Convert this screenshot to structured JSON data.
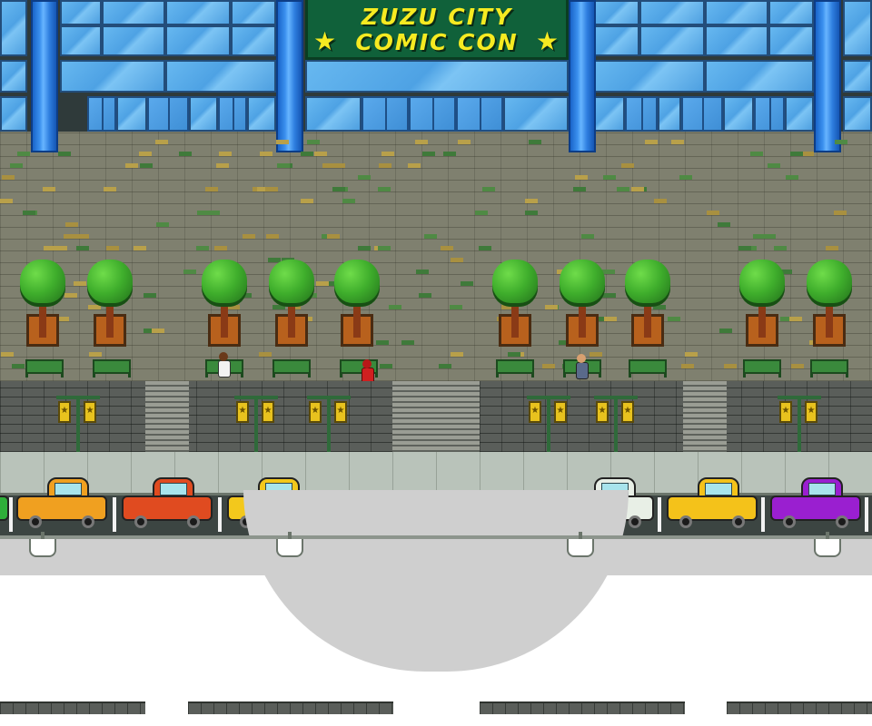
{
  "scene": {
    "title": "Zuzu City Comic Con plaza",
    "sign": {
      "line1": "ZUZU CITY",
      "line2": "COMIC CON",
      "star_icon": "star-icon"
    },
    "colors": {
      "glass": "#4ea2e4",
      "pillar": "#2f7fe0",
      "sign_bg": "#10613a",
      "sign_text": "#f6ea21",
      "plaza": "#7f806f",
      "tree": "#3fae2c",
      "planter": "#b8611d",
      "wall": "#5a5e5a",
      "road": "#3c4542"
    },
    "banner_icon": "star-icon",
    "cars": [
      {
        "name": "car-green-partial",
        "color": "#2fae3a"
      },
      {
        "name": "car-orange",
        "color": "#f0a020"
      },
      {
        "name": "car-red",
        "color": "#e04b20"
      },
      {
        "name": "car-yellow-taxi",
        "color": "#f3c81c"
      },
      {
        "name": "car-white",
        "color": "#e8efe6"
      },
      {
        "name": "car-yellow",
        "color": "#f4c21a"
      },
      {
        "name": "car-purple",
        "color": "#9a1fd0"
      }
    ],
    "characters": [
      {
        "name": "npc-brown-hair",
        "hair": "#6a3a1a",
        "outfit": "#f2f2f2"
      },
      {
        "name": "player-red",
        "hair": "#b81818",
        "outfit": "#d02020"
      },
      {
        "name": "npc-bald",
        "hair": "#d8a070",
        "outfit": "#5a6a8a"
      }
    ]
  }
}
